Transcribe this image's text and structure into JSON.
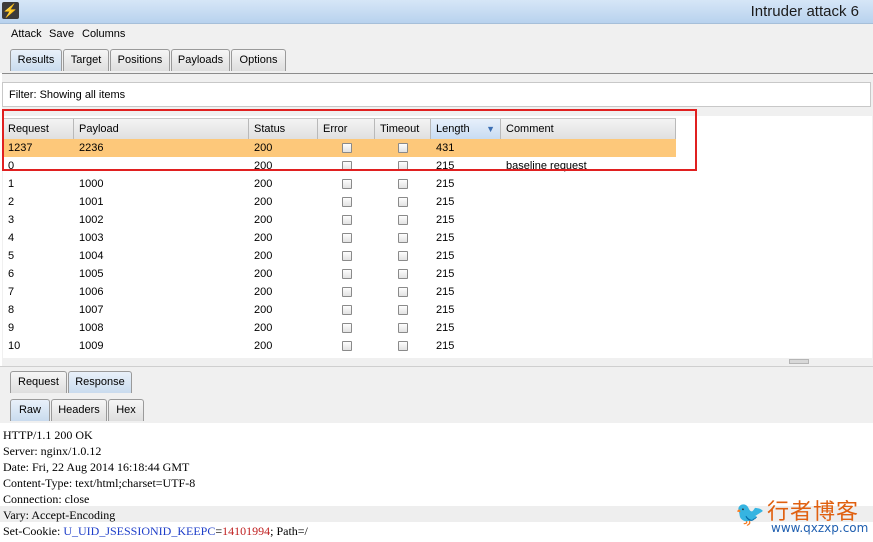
{
  "window": {
    "title": "Intruder attack 6"
  },
  "menu": [
    "Attack",
    "Save",
    "Columns"
  ],
  "main_tabs": [
    "Results",
    "Target",
    "Positions",
    "Payloads",
    "Options"
  ],
  "filter": {
    "label": "Filter:",
    "value": "Showing all items"
  },
  "table": {
    "columns": [
      "Request",
      "Payload",
      "Status",
      "Error",
      "Timeout",
      "Length",
      "Comment"
    ],
    "sorted_column": "Length",
    "rows": [
      {
        "request": "1237",
        "payload": "2236",
        "status": "200",
        "error": false,
        "timeout": false,
        "length": "431",
        "comment": ""
      },
      {
        "request": "0",
        "payload": "",
        "status": "200",
        "error": false,
        "timeout": false,
        "length": "215",
        "comment": "baseline request"
      },
      {
        "request": "1",
        "payload": "1000",
        "status": "200",
        "error": false,
        "timeout": false,
        "length": "215",
        "comment": ""
      },
      {
        "request": "2",
        "payload": "1001",
        "status": "200",
        "error": false,
        "timeout": false,
        "length": "215",
        "comment": ""
      },
      {
        "request": "3",
        "payload": "1002",
        "status": "200",
        "error": false,
        "timeout": false,
        "length": "215",
        "comment": ""
      },
      {
        "request": "4",
        "payload": "1003",
        "status": "200",
        "error": false,
        "timeout": false,
        "length": "215",
        "comment": ""
      },
      {
        "request": "5",
        "payload": "1004",
        "status": "200",
        "error": false,
        "timeout": false,
        "length": "215",
        "comment": ""
      },
      {
        "request": "6",
        "payload": "1005",
        "status": "200",
        "error": false,
        "timeout": false,
        "length": "215",
        "comment": ""
      },
      {
        "request": "7",
        "payload": "1006",
        "status": "200",
        "error": false,
        "timeout": false,
        "length": "215",
        "comment": ""
      },
      {
        "request": "8",
        "payload": "1007",
        "status": "200",
        "error": false,
        "timeout": false,
        "length": "215",
        "comment": ""
      },
      {
        "request": "9",
        "payload": "1008",
        "status": "200",
        "error": false,
        "timeout": false,
        "length": "215",
        "comment": ""
      },
      {
        "request": "10",
        "payload": "1009",
        "status": "200",
        "error": false,
        "timeout": false,
        "length": "215",
        "comment": ""
      }
    ]
  },
  "detail_tabs": [
    "Request",
    "Response"
  ],
  "view_tabs": [
    "Raw",
    "Headers",
    "Hex"
  ],
  "response": {
    "status_line": "HTTP/1.1 200 OK",
    "server": "Server: nginx/1.0.12",
    "date": "Date: Fri, 22 Aug 2014 16:18:44 GMT",
    "content_type": "Content-Type: text/html;charset=UTF-8",
    "connection": "Connection: close",
    "vary": "Vary: Accept-Encoding",
    "cookie_prefix": "Set-Cookie: ",
    "cookie_name": "U_UID_JSESSIONID_KEEPC",
    "cookie_eq": "=",
    "cookie_value": "14101994",
    "cookie_suffix": "; Path=/"
  },
  "watermark": {
    "text": "行者博客",
    "url": "www.qxzxp.com"
  },
  "colors": {
    "selected_row": "#fdc87a",
    "highlight_box": "#e02020",
    "titlebar": "#c9dcf1"
  }
}
